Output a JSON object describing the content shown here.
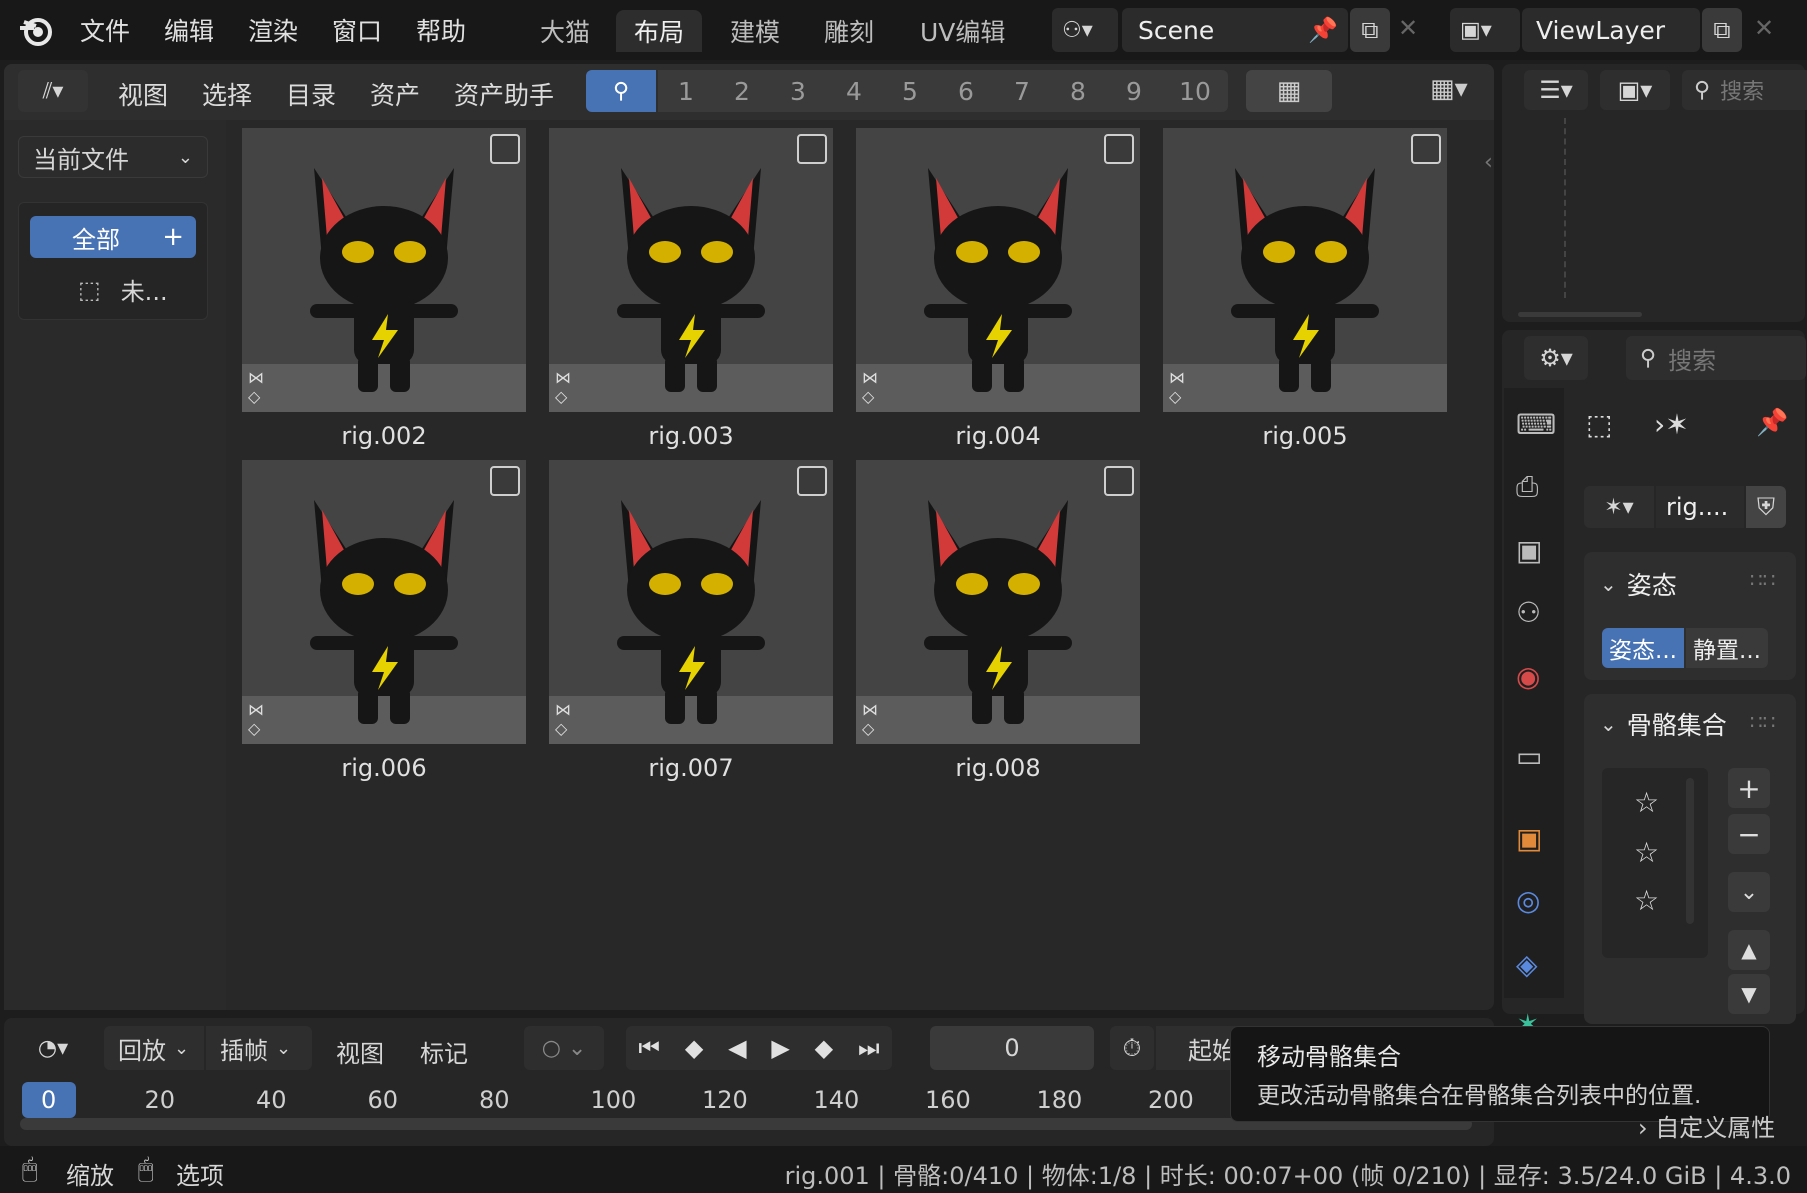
{
  "menu": [
    "文件",
    "编辑",
    "渲染",
    "窗口",
    "帮助"
  ],
  "workspaces": [
    {
      "label": "大猫",
      "active": false
    },
    {
      "label": "布局",
      "active": true
    },
    {
      "label": "建模",
      "active": false
    },
    {
      "label": "雕刻",
      "active": false
    },
    {
      "label": "UV编辑",
      "active": false
    }
  ],
  "scene": {
    "name": "Scene"
  },
  "view_layer": {
    "name": "ViewLayer"
  },
  "asset_header": {
    "items": [
      "视图",
      "选择",
      "目录",
      "资产",
      "资产助手"
    ],
    "numbers": [
      "1",
      "2",
      "3",
      "4",
      "5",
      "6",
      "7",
      "8",
      "9",
      "10"
    ]
  },
  "library": {
    "selected": "当前文件"
  },
  "catalogs": {
    "all": "全部",
    "unassigned": "未..."
  },
  "assets": [
    "rig.002",
    "rig.003",
    "rig.004",
    "rig.005",
    "rig.006",
    "rig.007",
    "rig.008"
  ],
  "outliner": {
    "search_placeholder": "搜索"
  },
  "properties": {
    "search_placeholder": "搜索",
    "object_name": "rig....",
    "pose_panel": {
      "title": "姿态",
      "btn_pose": "姿态...",
      "btn_rest": "静置..."
    },
    "bone_collections": {
      "title": "骨骼集合"
    },
    "custom_props": "自定义属性"
  },
  "timeline": {
    "playback": "回放",
    "keying": "插帧",
    "view": "视图",
    "marker": "标记",
    "current_frame": "0",
    "start_label": "起始",
    "ticks": [
      "0",
      "20",
      "40",
      "60",
      "80",
      "100",
      "120",
      "140",
      "160",
      "180",
      "200"
    ]
  },
  "tooltip": {
    "title": "移动骨骼集合",
    "body": "更改活动骨骼集合在骨骼集合列表中的位置."
  },
  "statusbar": {
    "zoom": "缩放",
    "options": "选项",
    "info": "rig.001 | 骨骼:0/410 | 物体:1/8 | 时长: 00:07+00 (帧 0/210) | 显存: 3.5/24.0 GiB | 4.3.0"
  },
  "colors": {
    "accent": "#4772b3",
    "ear": "#d23a3a",
    "eye": "#d4b000",
    "bolt": "#e6d200"
  }
}
